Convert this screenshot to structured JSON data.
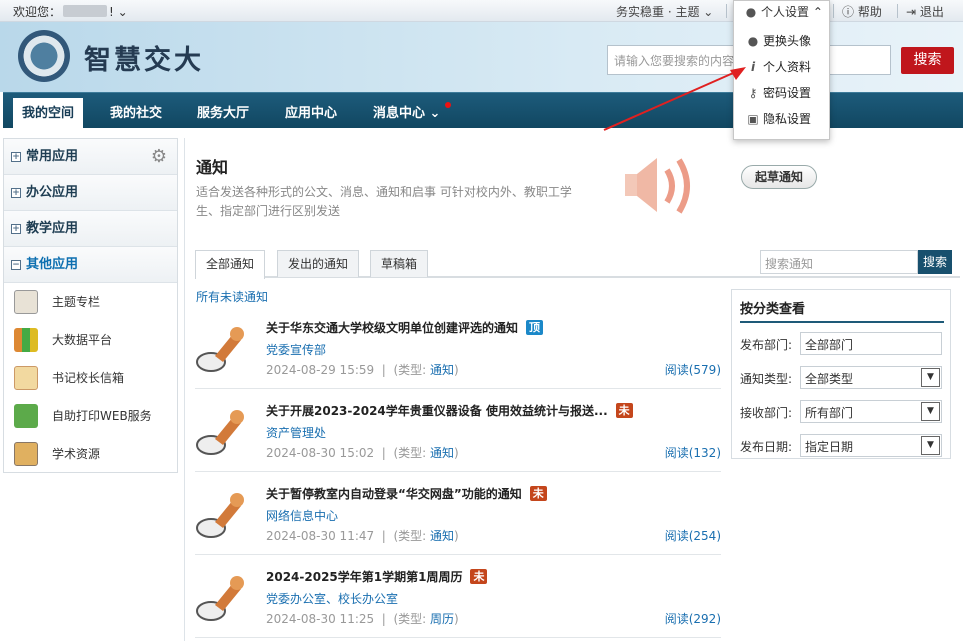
{
  "topbar": {
    "welcome": "欢迎您：",
    "user_suffix": "!",
    "theme": "务实稳重 · 主题",
    "help": "帮助",
    "logout": "退出"
  },
  "header": {
    "title": "智慧交大",
    "search_placeholder": "请输入您要搜索的内容",
    "search_btn": "搜索"
  },
  "nav": {
    "tabs": [
      "我的空间",
      "我的社交",
      "服务大厅",
      "应用中心",
      "消息中心"
    ]
  },
  "sidebar": {
    "sections": [
      "常用应用",
      "办公应用",
      "教学应用",
      "其他应用"
    ],
    "items": [
      "主题专栏",
      "大数据平台",
      "书记校长信箱",
      "自助打印WEB服务",
      "学术资源"
    ]
  },
  "notice": {
    "title": "通知",
    "desc": "适合发送各种形式的公文、消息、通知和启事 可针对校内外、教职工学生、指定部门进行区别发送",
    "draft_btn": "起草通知",
    "tabs": [
      "全部通知",
      "发出的通知",
      "草稿箱"
    ],
    "search_placeholder": "搜索通知",
    "search_btn": "搜索",
    "unread_link": "所有未读通知",
    "type_prefix": "(类型:",
    "type_suffix": ")",
    "read_prefix": "阅读(",
    "read_suffix": ")"
  },
  "notices": [
    {
      "title": "关于华东交通大学校级文明单位创建评选的通知",
      "badge": "顶",
      "badge_color": "#1b88c8",
      "dept": "党委宣传部",
      "date": "2024-08-29 15:59",
      "type": "通知",
      "reads": "579"
    },
    {
      "title": "关于开展2023-2024学年贵重仪器设备 使用效益统计与报送...",
      "badge": "未",
      "badge_color": "#c4461c",
      "dept": "资产管理处",
      "date": "2024-08-30 15:02",
      "type": "通知",
      "reads": "132"
    },
    {
      "title": "关于暂停教室内自动登录“华交网盘”功能的通知",
      "badge": "未",
      "badge_color": "#c4461c",
      "dept": "网络信息中心",
      "date": "2024-08-30 11:47",
      "type": "通知",
      "reads": "254"
    },
    {
      "title": "2024-2025学年第1学期第1周周历",
      "badge": "未",
      "badge_color": "#c4461c",
      "dept": "党委办公室、校长办公室",
      "date": "2024-08-30 11:25",
      "type": "周历",
      "reads": "292"
    }
  ],
  "filter": {
    "title": "按分类查看",
    "rows": [
      {
        "label": "发布部门:",
        "value": "全部部门"
      },
      {
        "label": "通知类型:",
        "value": "全部类型"
      },
      {
        "label": "接收部门:",
        "value": "所有部门"
      },
      {
        "label": "发布日期:",
        "value": "指定日期"
      }
    ]
  },
  "dropdown": {
    "head": "个人设置",
    "items": [
      "更换头像",
      "个人资料",
      "密码设置",
      "隐私设置"
    ]
  }
}
